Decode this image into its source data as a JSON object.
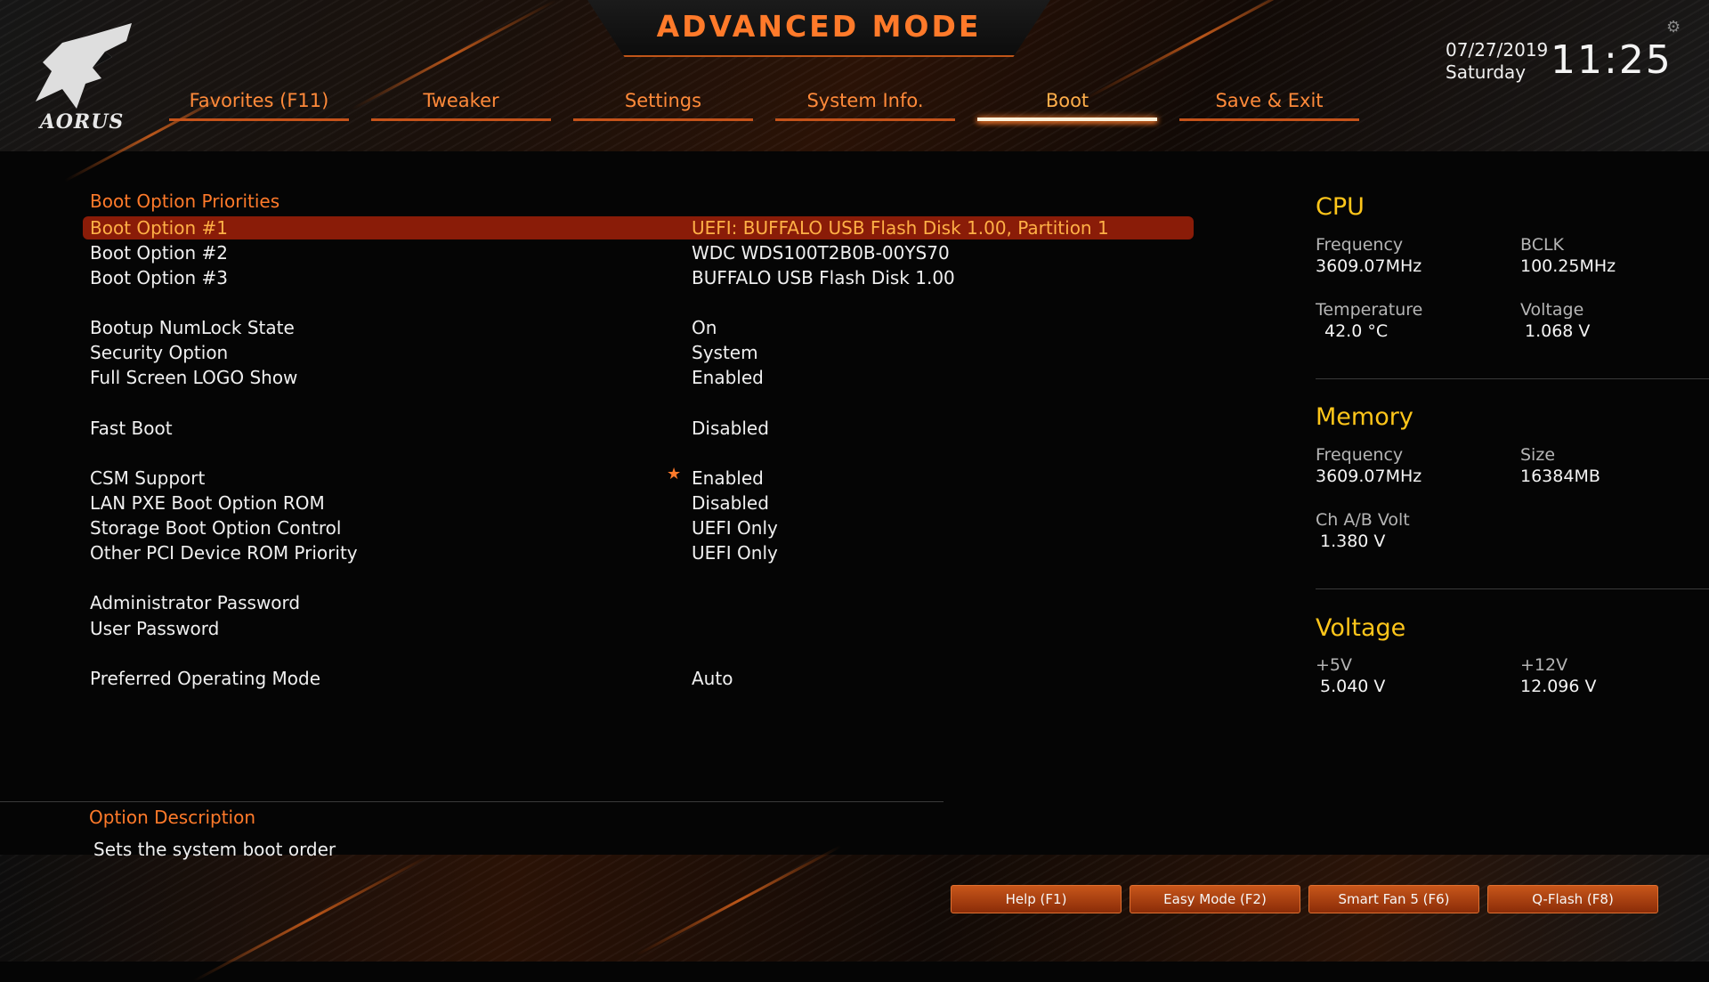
{
  "header": {
    "mode_title": "ADVANCED MODE",
    "logo_text": "AORUS",
    "date": "07/27/2019",
    "day": "Saturday",
    "time": "11:25"
  },
  "tabs": [
    {
      "label": "Favorites (F11)"
    },
    {
      "label": "Tweaker"
    },
    {
      "label": "Settings"
    },
    {
      "label": "System Info."
    },
    {
      "label": "Boot",
      "active": true
    },
    {
      "label": "Save & Exit"
    }
  ],
  "main": {
    "section_title": "Boot Option Priorities",
    "options": [
      {
        "label": "Boot Option #1",
        "value": "UEFI: BUFFALO USB Flash Disk 1.00, Partition 1",
        "selected": true
      },
      {
        "label": "Boot Option #2",
        "value": "WDC  WDS100T2B0B-00YS70"
      },
      {
        "label": "Boot Option #3",
        "value": "BUFFALO USB Flash Disk 1.00"
      },
      {
        "label": "Bootup NumLock State",
        "value": "On"
      },
      {
        "label": "Security Option",
        "value": "System"
      },
      {
        "label": "Full Screen LOGO Show",
        "value": "Enabled"
      },
      {
        "label": "Fast Boot",
        "value": "Disabled"
      },
      {
        "label": "CSM Support",
        "value": "Enabled",
        "starred": true
      },
      {
        "label": "LAN PXE Boot Option ROM",
        "value": "Disabled"
      },
      {
        "label": "Storage Boot Option Control",
        "value": "UEFI Only"
      },
      {
        "label": "Other PCI Device ROM Priority",
        "value": "UEFI Only"
      },
      {
        "label": "Administrator Password",
        "value": ""
      },
      {
        "label": "User Password",
        "value": ""
      },
      {
        "label": "Preferred Operating Mode",
        "value": "Auto"
      }
    ],
    "star_glyph": "★"
  },
  "description": {
    "title": "Option Description",
    "text": "Sets the system boot order"
  },
  "panel": {
    "cpu": {
      "title": "CPU",
      "frequency_label": "Frequency",
      "frequency": "3609.07MHz",
      "bclk_label": "BCLK",
      "bclk": "100.25MHz",
      "temperature_label": "Temperature",
      "temperature": "42.0 °C",
      "voltage_label": "Voltage",
      "voltage": "1.068 V"
    },
    "memory": {
      "title": "Memory",
      "frequency_label": "Frequency",
      "frequency": "3609.07MHz",
      "size_label": "Size",
      "size": "16384MB",
      "chab_label": "Ch A/B Volt",
      "chab": "1.380 V"
    },
    "voltage": {
      "title": "Voltage",
      "p5_label": "+5V",
      "p5": "5.040 V",
      "p12_label": "+12V",
      "p12": "12.096 V"
    }
  },
  "footer_buttons": [
    {
      "label": "Help (F1)"
    },
    {
      "label": "Easy Mode (F2)"
    },
    {
      "label": "Smart Fan 5 (F6)"
    },
    {
      "label": "Q-Flash (F8)"
    }
  ],
  "colors": {
    "accent": "#ff7a2a",
    "selected_row": "#8a1c08",
    "panel_title": "#ffc61a"
  },
  "icons": {
    "logo": "aorus-eagle-icon",
    "settings": "gear-icon",
    "modified": "star-icon"
  }
}
